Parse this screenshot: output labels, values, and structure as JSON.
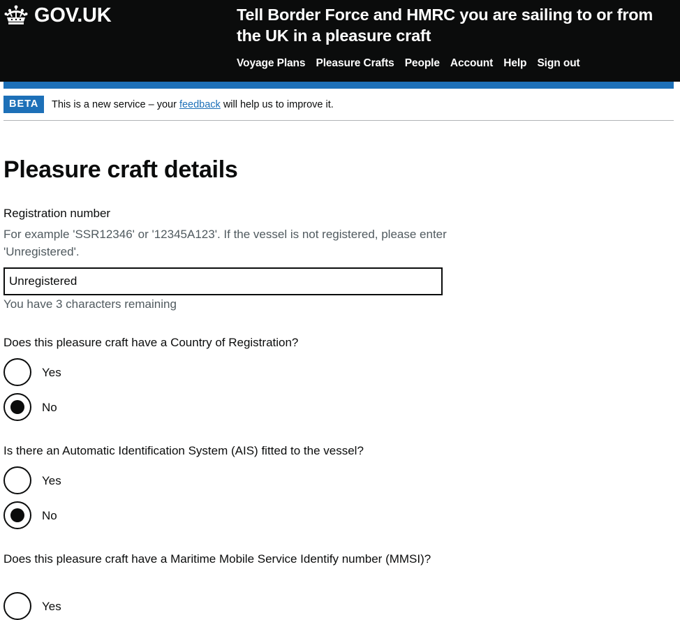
{
  "header": {
    "logo_text": "GOV.UK",
    "service_name": "Tell Border Force and HMRC you are sailing to or from the UK in a pleasure craft",
    "nav": [
      "Voyage Plans",
      "Pleasure Crafts",
      "People",
      "Account",
      "Help",
      "Sign out"
    ]
  },
  "phase_banner": {
    "tag": "BETA",
    "text_before": "This is a new service – your",
    "link": "feedback",
    "text_after": "will help us to improve it."
  },
  "page": {
    "title": "Pleasure craft details"
  },
  "registration": {
    "label": "Registration number",
    "hint": "For example 'SSR12346' or '12345A123'. If the vessel is not registered, please enter 'Unregistered'.",
    "value": "Unregistered",
    "remaining": "You have 3 characters remaining"
  },
  "country_question": {
    "label": "Does this pleasure craft have a Country of Registration?",
    "options": [
      "Yes",
      "No"
    ],
    "selected": "No"
  },
  "ais_question": {
    "label": "Is there an Automatic Identification System (AIS) fitted to the vessel?",
    "options": [
      "Yes",
      "No"
    ],
    "selected": "No"
  },
  "mmsi_question": {
    "label": "Does this pleasure craft have a Maritime Mobile Service Identify number (MMSI)?",
    "options": [
      "Yes"
    ]
  },
  "colors": {
    "header_bg": "#0b0c0c",
    "brand_blue": "#1d70b8",
    "hint_grey": "#505a5f",
    "link_blue": "#1d70b8"
  }
}
